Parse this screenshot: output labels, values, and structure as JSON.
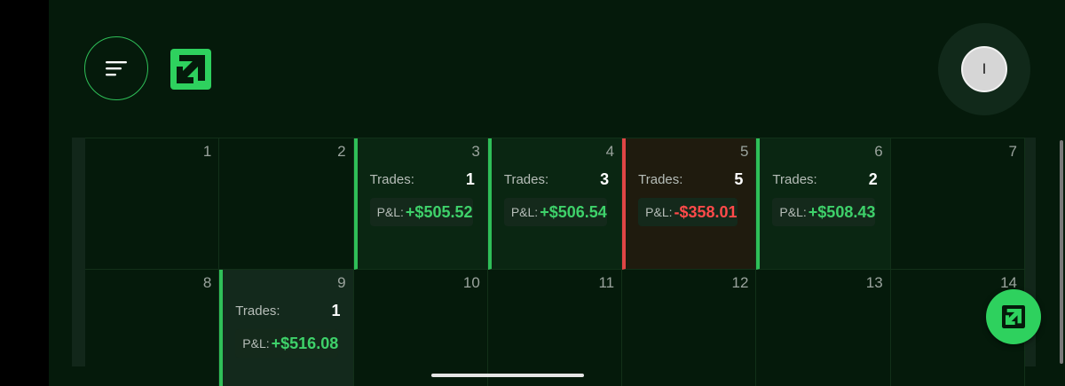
{
  "header": {
    "menu_icon": "menu-lines-icon",
    "logo_icon": "arrow-box-logo",
    "avatar_initial": "I"
  },
  "colors": {
    "background": "#051a0b",
    "accent": "#2fbf58",
    "profit": "#3ed16a",
    "loss": "#ff4a4a"
  },
  "calendar": {
    "trades_label": "Trades:",
    "pnl_label": "P&L:",
    "weeks": [
      [
        {
          "day": "1"
        },
        {
          "day": "2"
        },
        {
          "day": "3",
          "trades": "1",
          "pnl": "+$505.52",
          "status": "win"
        },
        {
          "day": "4",
          "trades": "3",
          "pnl": "+$506.54",
          "status": "win"
        },
        {
          "day": "5",
          "trades": "5",
          "pnl": "-$358.01",
          "status": "loss"
        },
        {
          "day": "6",
          "trades": "2",
          "pnl": "+$508.43",
          "status": "win"
        },
        {
          "day": "7"
        }
      ],
      [
        {
          "day": "8"
        },
        {
          "day": "9",
          "trades": "1",
          "pnl": "+$516.08",
          "status": "win",
          "selected": true
        },
        {
          "day": "10"
        },
        {
          "day": "11"
        },
        {
          "day": "12"
        },
        {
          "day": "13"
        },
        {
          "day": "14"
        }
      ]
    ]
  },
  "fab_icon": "arrow-box-logo"
}
